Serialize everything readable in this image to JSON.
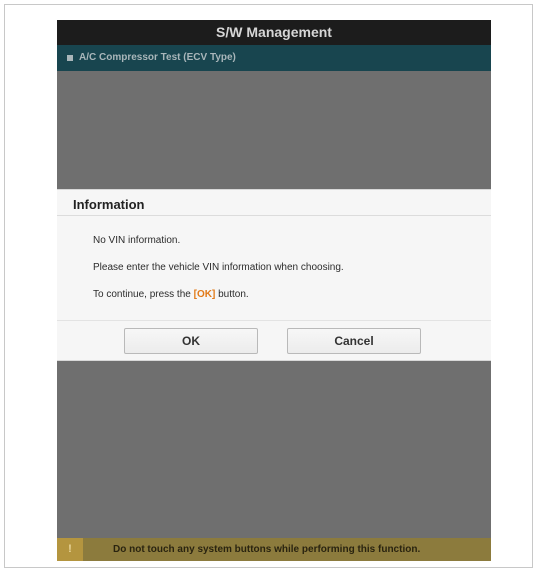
{
  "header": {
    "title": "S/W Management",
    "breadcrumb": "A/C Compressor Test (ECV Type)"
  },
  "dialog": {
    "title": "Information",
    "line1": "No VIN information.",
    "line2": "Please enter the vehicle VIN information when choosing.",
    "line3_prefix": "To continue, press the ",
    "line3_highlight": "[OK]",
    "line3_suffix": " button.",
    "ok_label": "OK",
    "cancel_label": "Cancel"
  },
  "footer": {
    "warning_icon": "!",
    "warning_text": "Do not touch any system buttons while performing this function."
  },
  "colors": {
    "titlebar": "#1c1c1c",
    "subbar": "#18454f",
    "background": "#6f6f6f",
    "highlight": "#e27a18",
    "warning": "#8c7b3d"
  }
}
